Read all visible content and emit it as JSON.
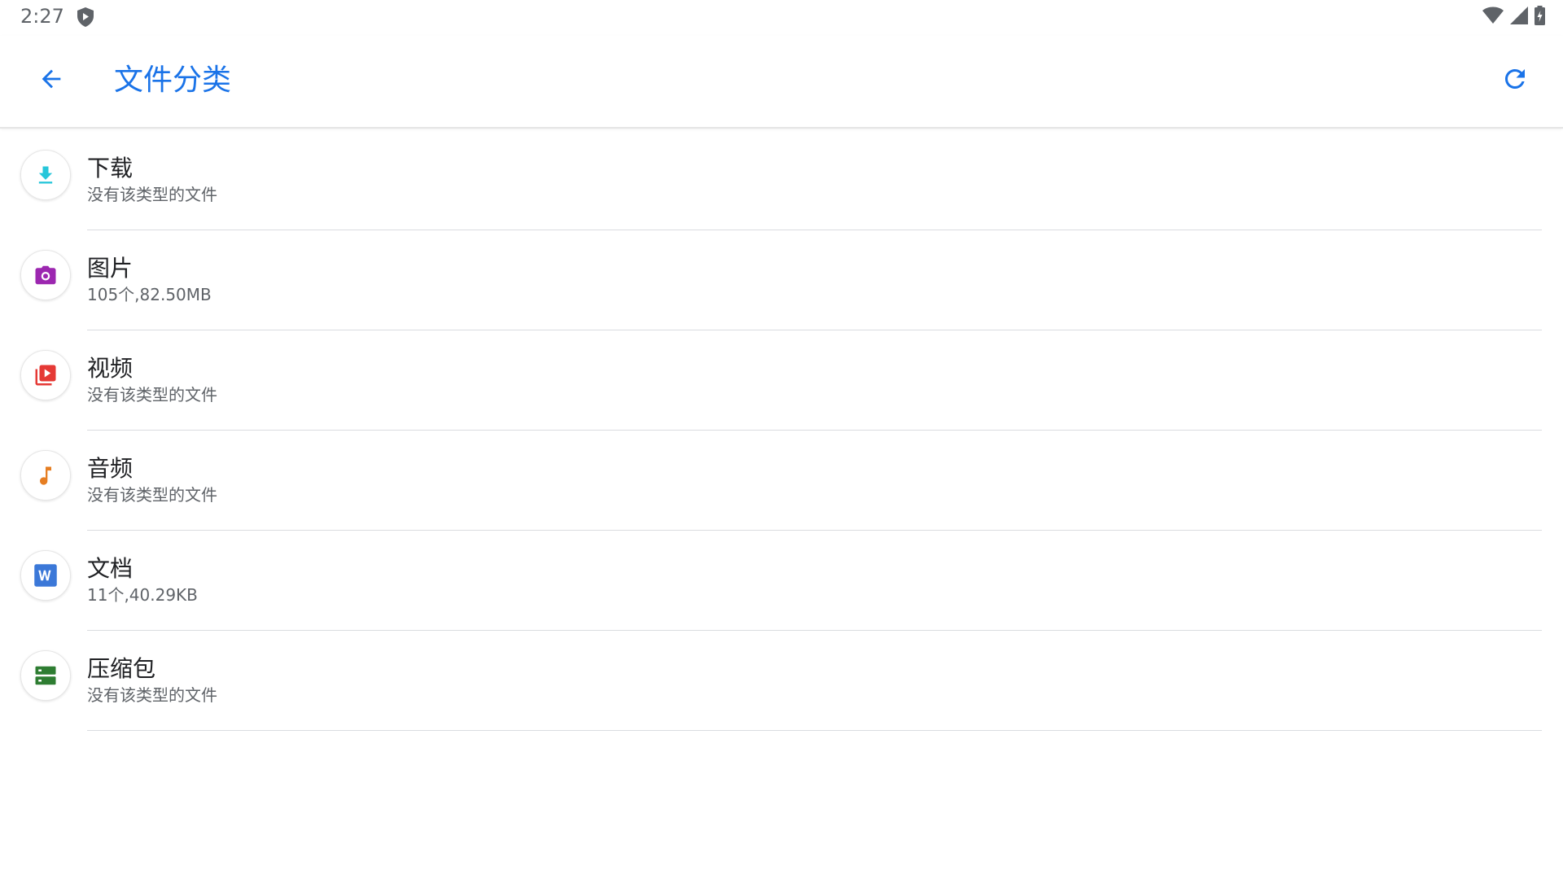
{
  "status_bar": {
    "time": "2:27",
    "icons": [
      "shield-icon",
      "wifi-icon",
      "signal-icon",
      "battery-icon"
    ]
  },
  "app_bar": {
    "title": "文件分类",
    "back_icon": "arrow-back-icon",
    "refresh_icon": "refresh-icon",
    "accent_color": "#1a73e8"
  },
  "categories": [
    {
      "title": "下载",
      "subtitle": "没有该类型的文件",
      "icon": "download-icon",
      "color": "#26c6da"
    },
    {
      "title": "图片",
      "subtitle": "105个,82.50MB",
      "icon": "camera-icon",
      "color": "#9c27b0"
    },
    {
      "title": "视频",
      "subtitle": "没有该类型的文件",
      "icon": "video-icon",
      "color": "#e53935"
    },
    {
      "title": "音频",
      "subtitle": "没有该类型的文件",
      "icon": "music-icon",
      "color": "#e67e22"
    },
    {
      "title": "文档",
      "subtitle": "11个,40.29KB",
      "icon": "word-doc-icon",
      "color": "#3b78d8"
    },
    {
      "title": "压缩包",
      "subtitle": "没有该类型的文件",
      "icon": "archive-icon",
      "color": "#2e7d32"
    }
  ]
}
